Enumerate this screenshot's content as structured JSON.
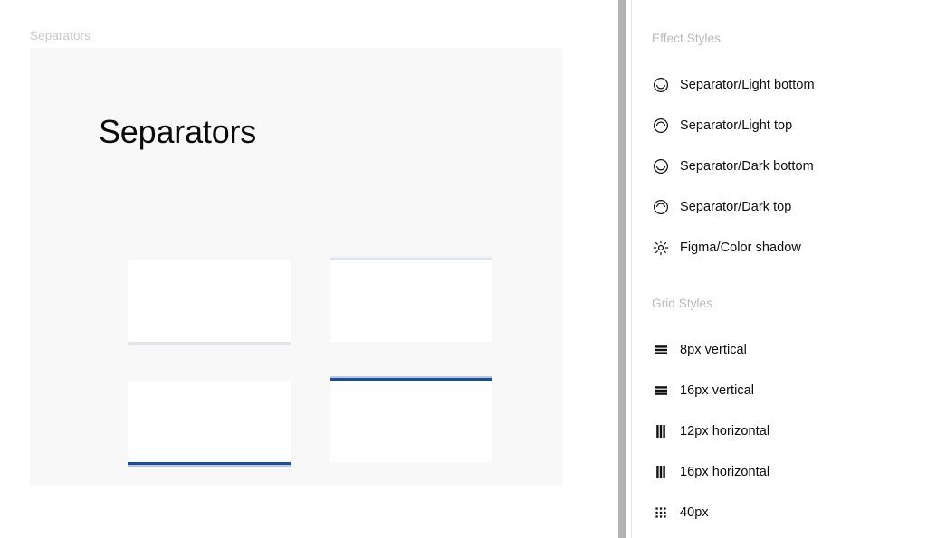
{
  "canvas": {
    "frame_label": "Separators",
    "frame_title": "Separators",
    "cards": [
      {
        "name": "separator-light-bottom",
        "style": "light",
        "edge": "bottom"
      },
      {
        "name": "separator-light-top",
        "style": "light",
        "edge": "top"
      },
      {
        "name": "separator-dark-bottom",
        "style": "dark",
        "edge": "bottom"
      },
      {
        "name": "separator-dark-top",
        "style": "dark",
        "edge": "top"
      }
    ]
  },
  "panel": {
    "effect_styles": {
      "title": "Effect Styles",
      "items": [
        {
          "label": "Separator/Light bottom",
          "icon": "effect-arc-bottom-icon"
        },
        {
          "label": "Separator/Light top",
          "icon": "effect-arc-top-icon"
        },
        {
          "label": "Separator/Dark bottom",
          "icon": "effect-arc-bottom-icon"
        },
        {
          "label": "Separator/Dark top",
          "icon": "effect-arc-top-icon"
        },
        {
          "label": "Figma/Color shadow",
          "icon": "sun-burst-icon"
        }
      ]
    },
    "grid_styles": {
      "title": "Grid Styles",
      "items": [
        {
          "label": "8px vertical",
          "icon": "rows-grid-icon"
        },
        {
          "label": "16px vertical",
          "icon": "rows-grid-icon"
        },
        {
          "label": "12px horizontal",
          "icon": "columns-grid-icon"
        },
        {
          "label": "16px horizontal",
          "icon": "columns-grid-icon"
        },
        {
          "label": "40px",
          "icon": "dot-grid-icon"
        }
      ]
    }
  },
  "colors": {
    "page_background": "#ffffff",
    "frame_background": "#f8f8f9",
    "card_background": "#ffffff",
    "separator_light": "#dde4ea",
    "separator_dark": "#1a4d9c",
    "label_muted": "#c9c9cb",
    "text_primary": "#0d0d0d",
    "scrollbar": "#b3b3b3"
  }
}
